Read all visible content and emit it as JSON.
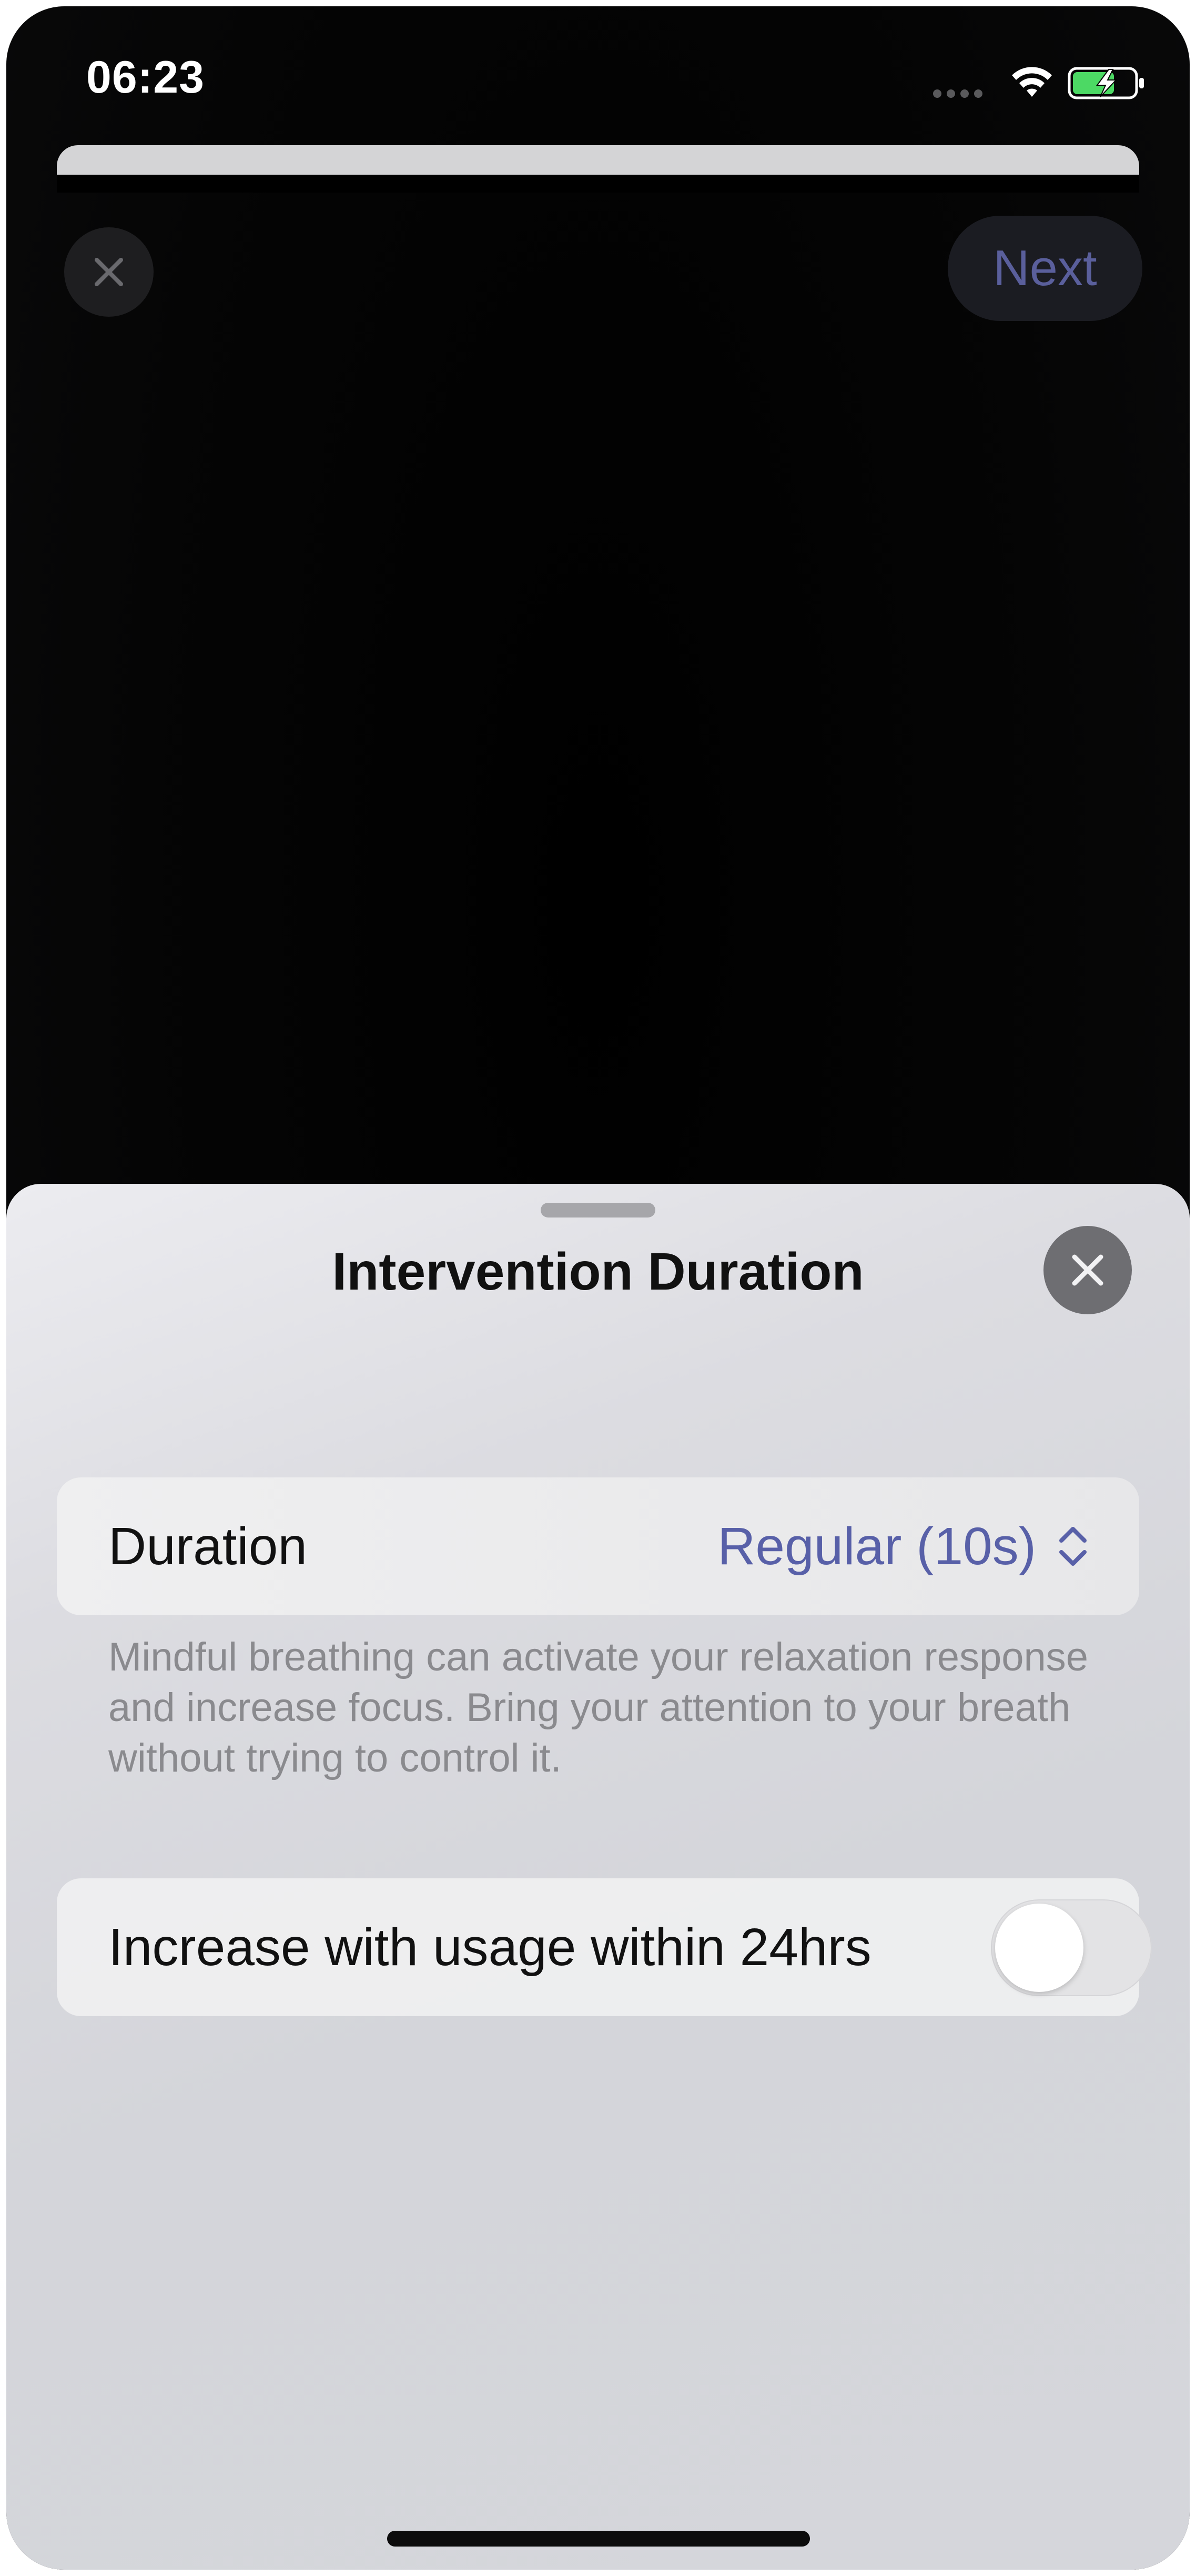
{
  "status_bar": {
    "time": "06:23",
    "icons": [
      "cellular-icon",
      "wifi-icon",
      "battery-charging-icon"
    ]
  },
  "background_screen": {
    "close_icon": "close-icon",
    "next_label": "Next"
  },
  "sheet": {
    "title": "Intervention Duration",
    "close_icon": "close-icon",
    "duration_row": {
      "label": "Duration",
      "value": "Regular (10s)",
      "icon": "chevron-up-down-icon"
    },
    "footnote": "Mindful breathing can activate your relaxation response and increase focus. Bring your attention to your breath without trying to control it.",
    "increase_row": {
      "label": "Increase with usage within 24hrs",
      "toggle_on": false
    }
  },
  "colors": {
    "accent": "#5860a8",
    "background": "#000000",
    "sheet": "#d5d6db"
  }
}
